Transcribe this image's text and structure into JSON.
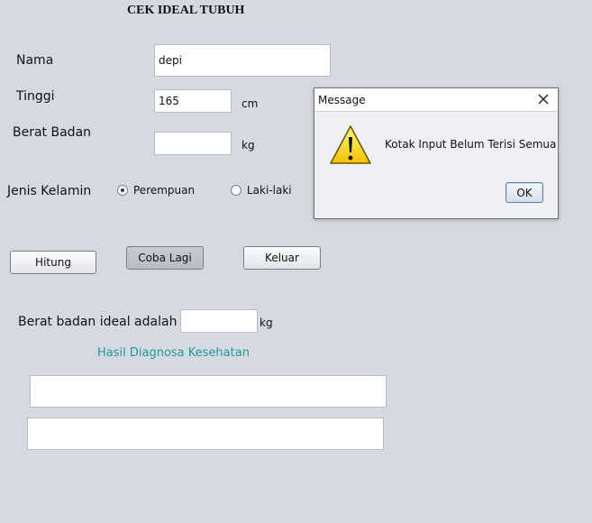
{
  "form": {
    "title": "CEK IDEAL TUBUH",
    "nama_label": "Nama",
    "nama_value": "depi",
    "tinggi_label": "Tinggi",
    "tinggi_value": "165",
    "tinggi_unit": "cm",
    "berat_label": "Berat Badan",
    "berat_value": "",
    "berat_unit": "kg",
    "gender_label": "Jenis Kelamin",
    "gender_options": [
      {
        "label": "Perempuan",
        "selected": true
      },
      {
        "label": "Laki-laki",
        "selected": false
      }
    ],
    "buttons": {
      "hitung": "Hitung",
      "coba_lagi": "Coba Lagi",
      "keluar": "Keluar"
    },
    "ideal_label": "Berat badan ideal adalah",
    "ideal_value": "",
    "ideal_unit": "kg",
    "diagnosa_label": "Hasil Diagnosa Kesehatan"
  },
  "dialog": {
    "title": "Message",
    "message": "Kotak Input Belum Terisi Semua",
    "ok_label": "OK",
    "icon": "warning-icon"
  },
  "colors": {
    "background": "#d6d9df",
    "diagnosa_text": "#1f9a98"
  }
}
